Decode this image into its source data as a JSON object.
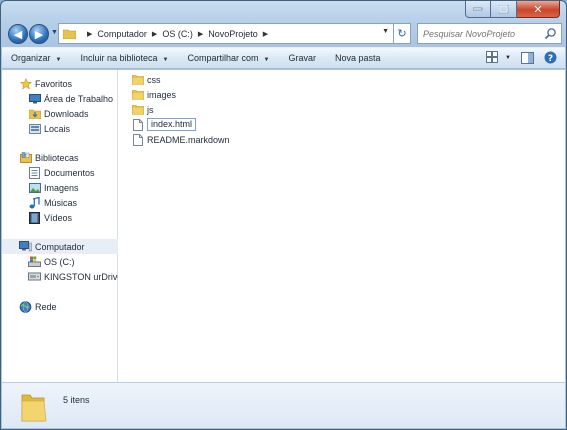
{
  "address": {
    "crumbs": [
      "Computador",
      "OS (C:)",
      "NovoProjeto"
    ]
  },
  "search": {
    "placeholder": "Pesquisar NovoProjeto"
  },
  "toolbar": {
    "organize": "Organizar",
    "include_library": "Incluir na biblioteca",
    "share": "Compartilhar com",
    "burn": "Gravar",
    "new_folder": "Nova pasta"
  },
  "navigation": {
    "favorites": {
      "label": "Favoritos",
      "items": [
        "Área de Trabalho",
        "Downloads",
        "Locais"
      ]
    },
    "libraries": {
      "label": "Bibliotecas",
      "items": [
        "Documentos",
        "Imagens",
        "Músicas",
        "Vídeos"
      ]
    },
    "computer": {
      "label": "Computador",
      "items": [
        "OS (C:)",
        "KINGSTON urDrive ("
      ]
    },
    "network": {
      "label": "Rede"
    }
  },
  "files": [
    {
      "name": "css",
      "type": "folder"
    },
    {
      "name": "images",
      "type": "folder"
    },
    {
      "name": "js",
      "type": "folder"
    },
    {
      "name": "index.html",
      "type": "file"
    },
    {
      "name": "README.markdown",
      "type": "file"
    }
  ],
  "details": {
    "count": "5 itens"
  },
  "colors": {
    "chrome": "#b7d0e8",
    "folder": "#e8c24a",
    "selection": "#e7eef6",
    "close": "#c9452a"
  }
}
